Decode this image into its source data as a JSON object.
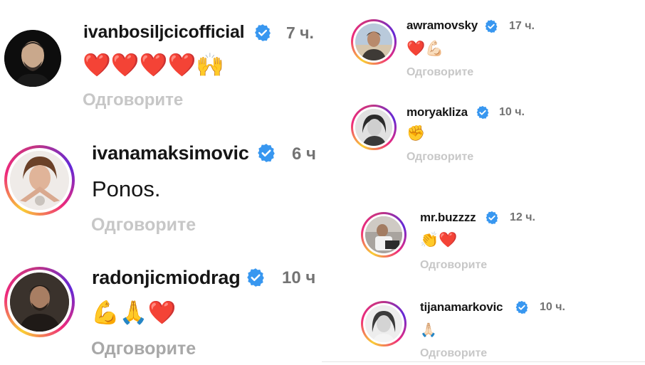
{
  "reply_label": "Одговорите",
  "comments": [
    {
      "username": "ivanbosiljcicofficial",
      "time": "7 ч.",
      "text": "❤️❤️❤️❤️🙌"
    },
    {
      "username": "ivanamaksimovic",
      "time": "6 ч",
      "text": "Ponos."
    },
    {
      "username": "radonjicmiodrag",
      "time": "10 ч",
      "text": "💪🙏❤️"
    },
    {
      "username": "awramovsky",
      "time": "17 ч.",
      "text": "❤️💪🏻"
    },
    {
      "username": "moryakliza",
      "time": "10 ч.",
      "text": "✊"
    },
    {
      "username": "mr.buzzzz",
      "time": "12 ч.",
      "text": "👏❤️"
    },
    {
      "username": "tijanamarkovic",
      "time": "10 ч.",
      "text": "🙏🏻"
    }
  ],
  "colors": {
    "verified": "#3897f0",
    "reply": "#c7c7c7",
    "time": "#737373",
    "ring_start": "#f9ce34",
    "ring_mid": "#ee2a7b",
    "ring_end": "#6228d7"
  }
}
